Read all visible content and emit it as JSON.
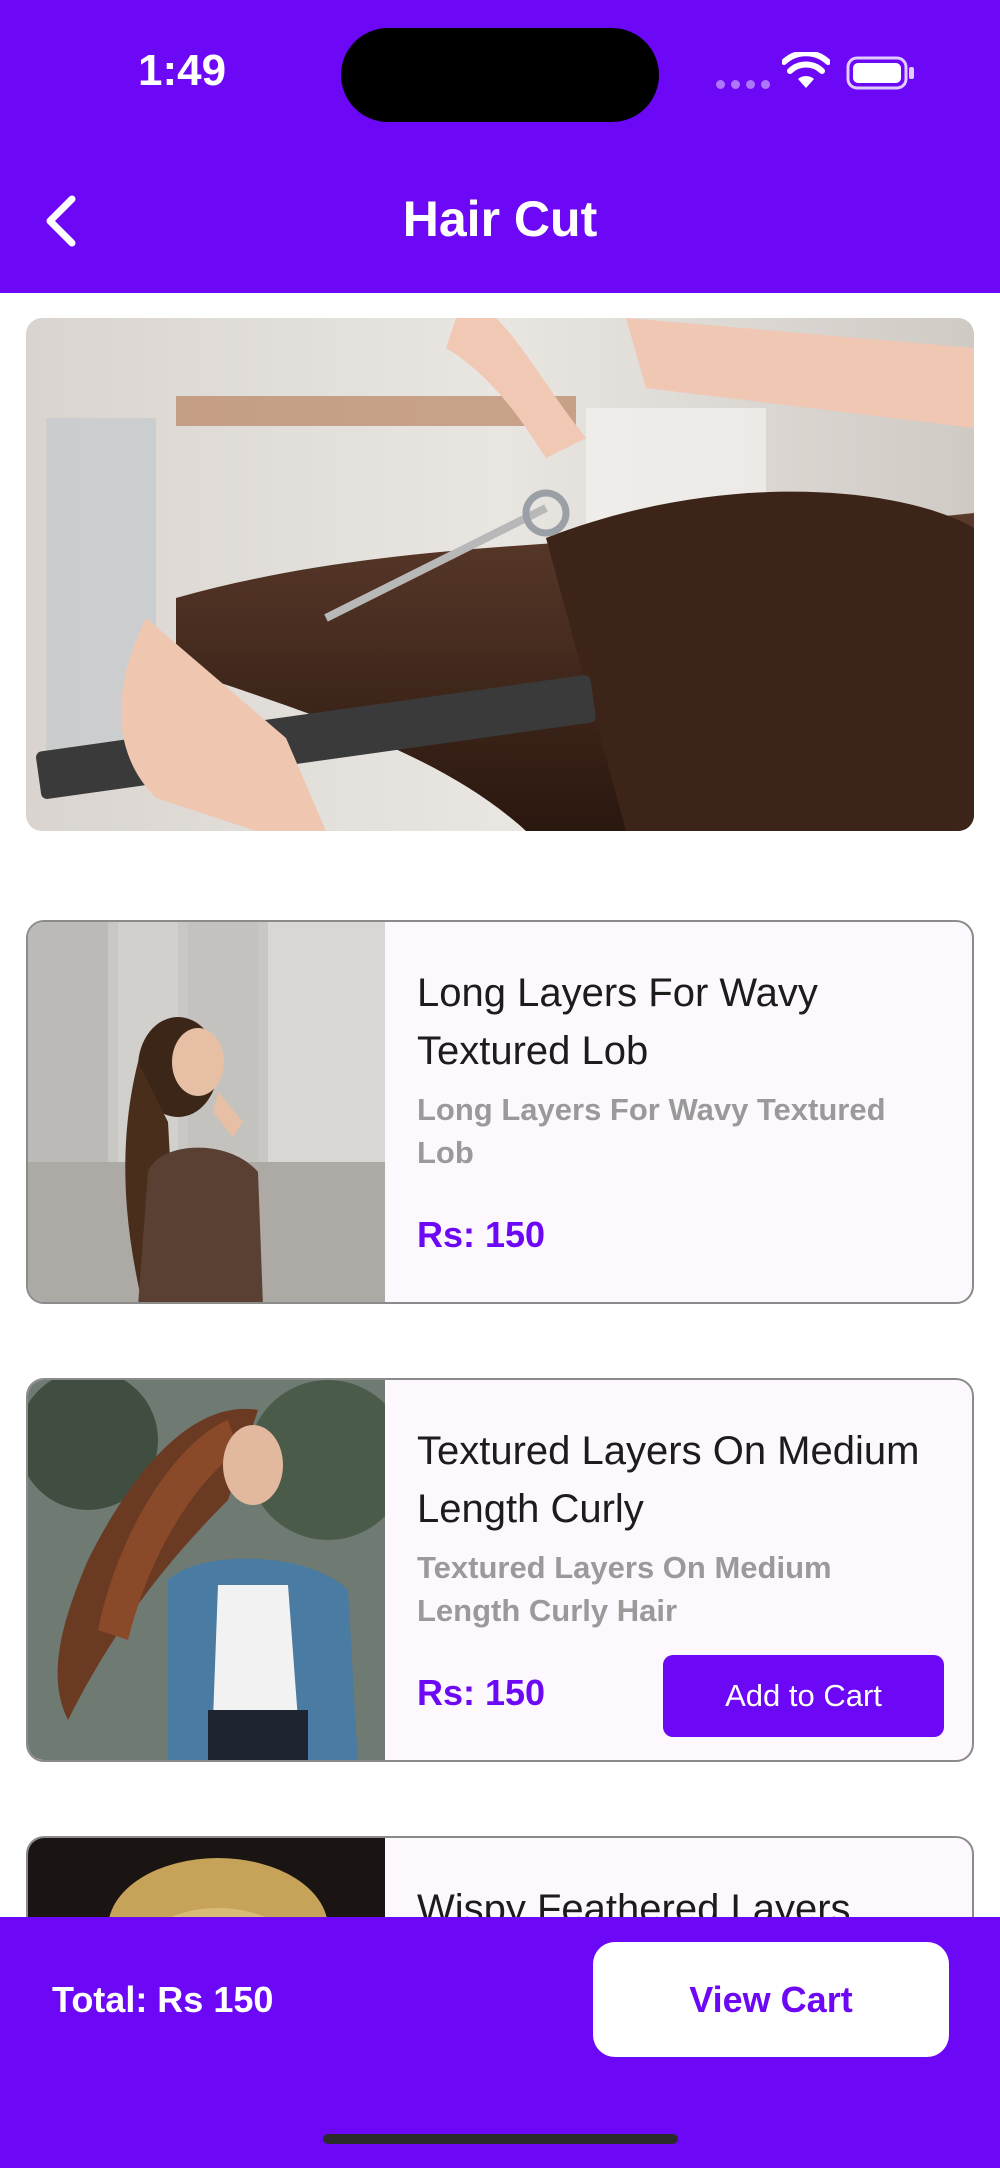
{
  "status": {
    "time": "1:49"
  },
  "header": {
    "title": "Hair Cut"
  },
  "services": [
    {
      "name": "Long Layers For Wavy Textured Lob",
      "description": "Long Layers For Wavy Textured Lob",
      "price": "Rs: 150"
    },
    {
      "name": "Textured Layers On Medium Length Curly",
      "description": "Textured Layers On Medium Length Curly Hair",
      "price": "Rs: 150",
      "button": "Add to Cart"
    },
    {
      "name": "Wispy Feathered Layers"
    }
  ],
  "footer": {
    "total": "Total: Rs 150",
    "view_cart": "View Cart"
  },
  "colors": {
    "accent": "#6c08f5",
    "text_muted": "#9a9a9a"
  }
}
